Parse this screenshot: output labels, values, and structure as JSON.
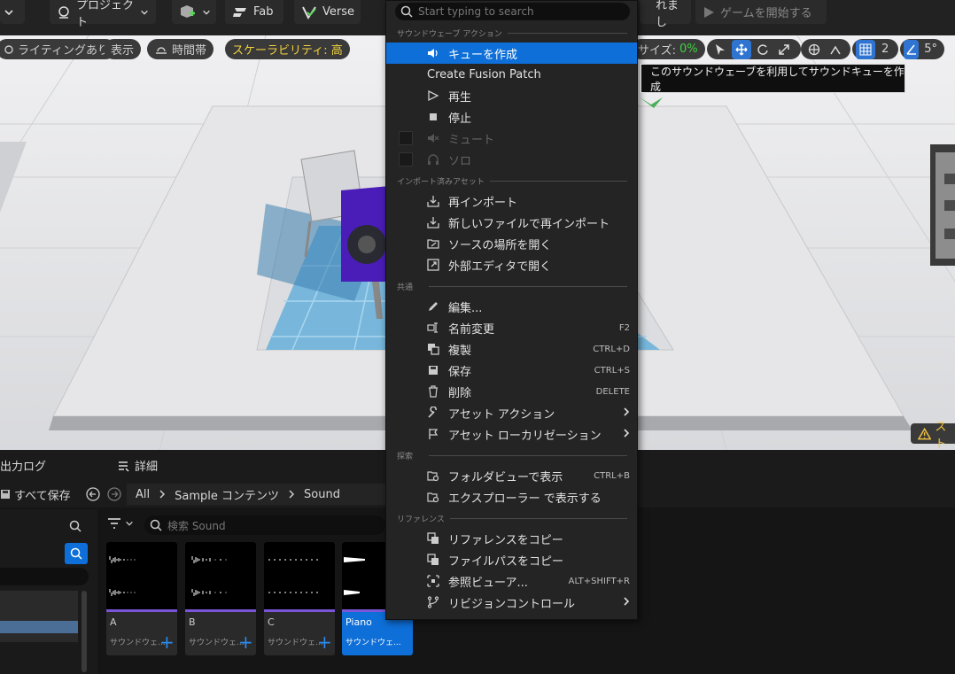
{
  "toolbar": {
    "left_fragment": "",
    "project_label": "プロジェクト",
    "fab_label": "Fab",
    "verse_label": "Verse",
    "unsaved_fragment": "れまし",
    "play_label": "ゲームを開始する"
  },
  "viewport": {
    "lighting_label": "ライティングあり",
    "show_label": "表示",
    "time_label": "時間帯",
    "scalability_label": "スケーラビリティ: 高",
    "size_label": "サイズ:",
    "size_value": "0%",
    "grid_value": "2",
    "angle_value": "5°",
    "warning_fragment": "スト"
  },
  "bottom": {
    "tab_catalog": "出力ログ",
    "tab_details": "詳細",
    "save_all": "すべて保存",
    "breadcrumb": [
      "All",
      "Sample コンテンツ",
      "Sound"
    ],
    "filter_placeholder": "検索 Sound",
    "assets": [
      {
        "name": "A",
        "type": "サウンドウェ...",
        "selected": false
      },
      {
        "name": "B",
        "type": "サウンドウェ...",
        "selected": false
      },
      {
        "name": "C",
        "type": "サウンドウェ...",
        "selected": false
      },
      {
        "name": "Piano",
        "type": "サウンドウェ...",
        "selected": true
      }
    ]
  },
  "menu": {
    "search_placeholder": "Start typing to search",
    "sections": {
      "soundwave": "サウンドウェーブ アクション",
      "imported": "インポート済みアセット",
      "common": "共通",
      "explore": "探索",
      "reference": "リファレンス"
    },
    "items": {
      "create_cue": "キューを作成",
      "fusion_patch": "Create Fusion Patch",
      "play": "再生",
      "stop": "停止",
      "mute": "ミュート",
      "solo": "ソロ",
      "reimport": "再インポート",
      "reimport_new": "新しいファイルで再インポート",
      "open_source": "ソースの場所を開く",
      "open_external": "外部エディタで開く",
      "edit": "編集...",
      "rename": "名前変更",
      "rename_sc": "F2",
      "duplicate": "複製",
      "duplicate_sc": "CTRL+D",
      "save": "保存",
      "save_sc": "CTRL+S",
      "delete": "削除",
      "delete_sc": "DELETE",
      "asset_actions": "アセット アクション",
      "asset_localization": "アセット ローカリゼーション",
      "show_in_folder": "フォルダビューで表示",
      "show_in_folder_sc": "CTRL+B",
      "show_in_explorer": "エクスプローラー で表示する",
      "copy_reference": "リファレンスをコピー",
      "copy_path": "ファイルパスをコピー",
      "ref_viewer": "参照ビューア...",
      "ref_viewer_sc": "ALT+SHIFT+R",
      "revision_control": "リビジョンコントロール"
    }
  },
  "tooltip": "このサウンドウェーブを利用してサウンドキューを作成"
}
